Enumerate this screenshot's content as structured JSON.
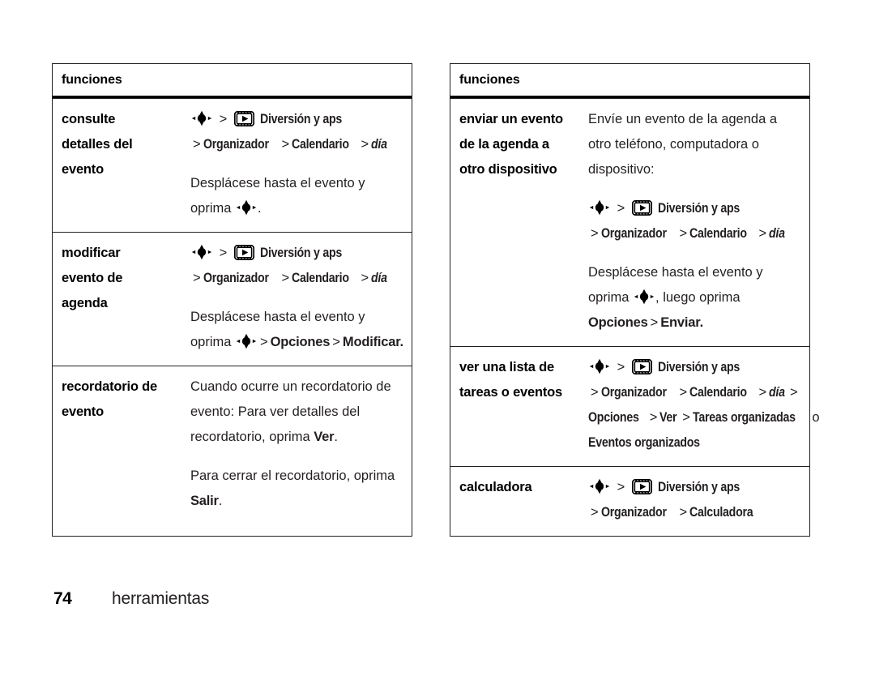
{
  "page": {
    "number": "74",
    "section_title": "herramientas"
  },
  "icons": {
    "nav_key": "navigation-key-icon",
    "media_key": "fun-and-apps-icon"
  },
  "tables": [
    {
      "header": "funciones",
      "rows": [
        {
          "label": "consulte detalles del evento",
          "label_lines": [
            "consulte",
            "detalles del",
            "evento"
          ],
          "menu_line1_prefix": "",
          "menu_line1_app": "Diversión y aps",
          "menu_line2": "> Organizador > Calendario > día",
          "menu_line2_parts": [
            "Organizador",
            "Calendario",
            "día"
          ],
          "body": "Desplácese hasta el evento y oprima .",
          "body_pre": "Desplácese hasta el evento y oprima ",
          "body_post": "."
        },
        {
          "label": "modificar evento de agenda",
          "label_lines": [
            "modificar",
            "evento de",
            "agenda"
          ],
          "menu_line1_app": "Diversión y aps",
          "menu_line2_parts": [
            "Organizador",
            "Calendario",
            "día"
          ],
          "body_pre": "Desplácese hasta el evento y oprima ",
          "body_post_menu": "> Opciones > Modificar.",
          "body_post_parts": [
            "Opciones",
            "Modificar."
          ]
        },
        {
          "label": "recordatorio de evento",
          "label_lines": [
            "recordatorio de",
            "evento"
          ],
          "para1_pre": "Cuando ocurre un recordatorio de evento: Para ver detalles del recordatorio, oprima ",
          "para1_key": "Ver",
          "para1_post": ".",
          "para2_pre": "Para cerrar el recordatorio, oprima ",
          "para2_key": "Salir",
          "para2_post": "."
        }
      ]
    },
    {
      "header": "funciones",
      "rows": [
        {
          "label": "enviar un evento de la agenda a otro dispositivo",
          "label_lines": [
            "enviar un evento",
            "de la agenda a",
            "otro dispositivo"
          ],
          "intro": "Envíe un evento de la agenda a otro teléfono, computadora o dispositivo:",
          "menu_line1_app": "Diversión y aps",
          "menu_line2_parts": [
            "Organizador",
            "Calendario",
            "día"
          ],
          "body_pre": "oprima ",
          "body_lead": "Desplácese hasta el evento y",
          "body_mid": ", luego oprima",
          "body_menu_parts": [
            "Opciones",
            "Enviar."
          ]
        },
        {
          "label": "ver una lista de tareas o eventos",
          "label_lines": [
            "ver una lista de",
            "tareas o eventos"
          ],
          "menu_line1_app": "Diversión y aps",
          "menu_line2_parts": [
            "Organizador",
            "Calendario",
            "día"
          ],
          "menu_line3_parts": [
            "Opciones",
            "Ver",
            "Tareas organizadas"
          ],
          "menu_line3_conj": "o",
          "menu_line4": "Eventos organizados"
        },
        {
          "label": "calculadora",
          "label_lines": [
            "calculadora"
          ],
          "menu_line1_app": "Diversión y aps",
          "menu_line2_parts": [
            "Organizador",
            "Calculadora"
          ]
        }
      ]
    }
  ]
}
